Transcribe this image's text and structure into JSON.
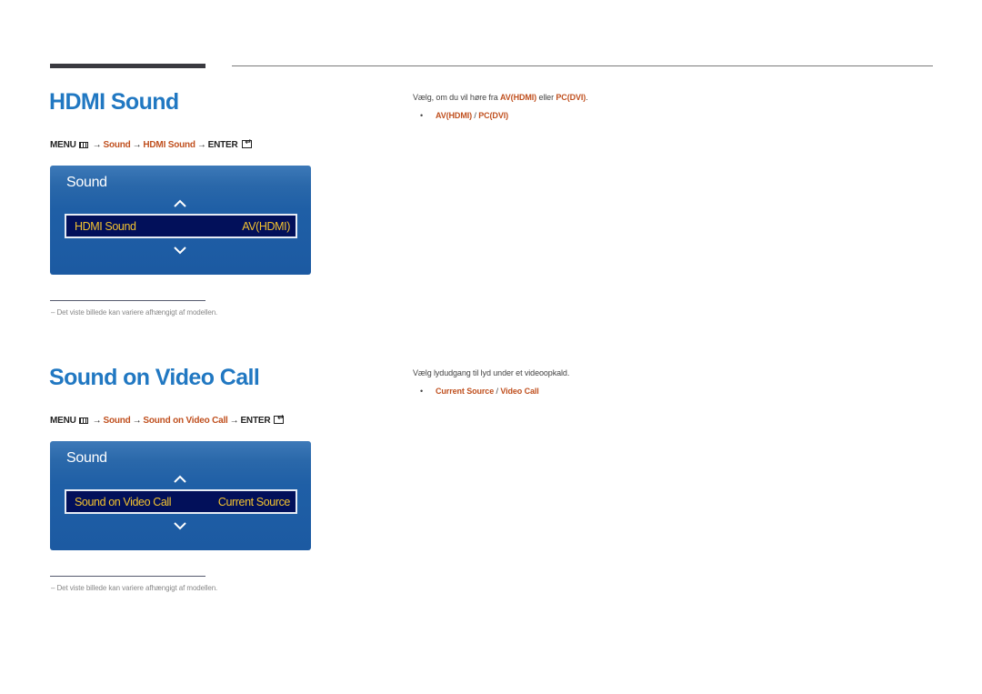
{
  "sections": [
    {
      "title": "HDMI Sound",
      "menu_path": {
        "menu": "MENU",
        "arrow": "→",
        "step1": "Sound",
        "step2": "HDMI Sound",
        "enter": "ENTER"
      },
      "osd": {
        "title": "Sound",
        "item_label": "HDMI Sound",
        "item_value": "AV(HDMI)"
      },
      "footnote": {
        "dash": "–",
        "text": "Det viste billede kan variere afhængigt af modellen."
      },
      "description": {
        "prefix": "Vælg, om du vil høre fra ",
        "opt1": "AV(HDMI)",
        "middle": " eller ",
        "opt2": "PC(DVI)",
        "suffix": "."
      },
      "options": {
        "bullet": "•",
        "first": "AV(HDMI)",
        "separator": " / ",
        "second": "PC(DVI)"
      }
    },
    {
      "title": "Sound on Video Call",
      "menu_path": {
        "menu": "MENU",
        "arrow": "→",
        "step1": "Sound",
        "step2": "Sound on Video Call",
        "enter": "ENTER"
      },
      "osd": {
        "title": "Sound",
        "item_label": "Sound on Video Call",
        "item_value": "Current Source"
      },
      "footnote": {
        "dash": "–",
        "text": "Det viste billede kan variere afhængigt af modellen."
      },
      "description": {
        "text": "Vælg lydudgang til lyd under et videoopkald."
      },
      "options": {
        "bullet": "•",
        "first": "Current Source",
        "separator": " / ",
        "second": "Video Call"
      }
    }
  ],
  "colors": {
    "heading": "#2178c2",
    "highlight": "#c0501f",
    "osd_bg": "#1f5fa6",
    "osd_row_bg": "#02105a",
    "osd_row_text": "#f2c230"
  }
}
